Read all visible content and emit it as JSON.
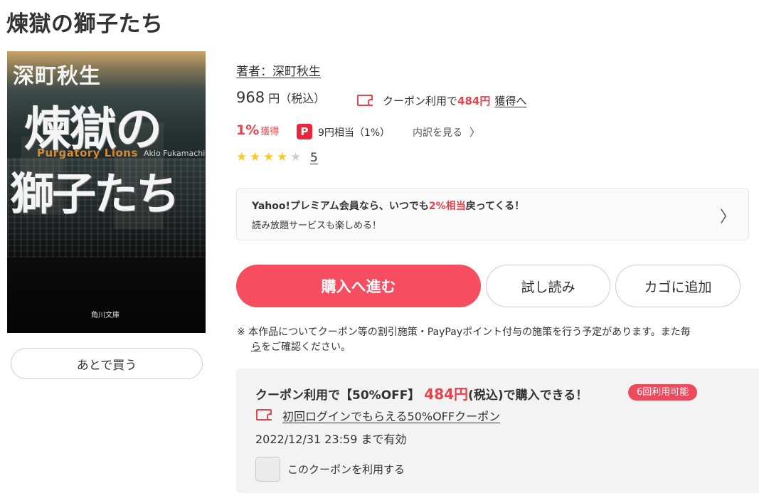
{
  "book": {
    "title": "煉獄の獅子たち",
    "cover": {
      "author": "深町秋生",
      "title_line_1": "煉獄の",
      "title_line_2": "獅子たち",
      "english_title": "Purgatory Lions",
      "english_author": "Akio Fukamachi",
      "publisher": "角川文庫"
    }
  },
  "actions": {
    "later_label": "あとで買う",
    "buy_label": "購入へ進む",
    "sample_label": "試し読み",
    "cart_label": "カゴに追加"
  },
  "info": {
    "author_link": "著者：深町秋生",
    "price_value": "968",
    "price_unit": "円（税込）",
    "coupon_prefix": "クーポン利用で",
    "coupon_price": "484円",
    "coupon_link": "獲得へ",
    "earn_percent": "1%",
    "earn_label": "獲得",
    "paypay_icon_glyph": "P",
    "paypay_amount": "9円相当（1%）",
    "breakdown_label": "内訳を見る",
    "rating_stars": 4,
    "rating_max": 5,
    "review_count": "5"
  },
  "premium": {
    "title_before": "Yahoo!プレミアム会員なら、いつでも",
    "title_highlight": "2%相当",
    "title_after": "戻ってくる！",
    "subtitle": "読み放題サービスも楽しめる！"
  },
  "notice": {
    "line1": "※ 本作品についてクーポン等の割引施策・PayPayポイント付与の施策を行う予定があります。また毎",
    "line2_link": "ら",
    "line2_rest": "をご確認ください。"
  },
  "coupon_panel": {
    "title_prefix": "クーポン利用で【50%OFF】",
    "title_price": "484円",
    "title_suffix": "(税込)で購入できる！",
    "badge": "6回利用可能",
    "coupon_name": "初回ログインでもらえる50%OFFクーポン",
    "valid_until": "2022/12/31 23:59 まで有効",
    "checkbox_label": "このクーポンを利用する",
    "checkbox_checked": false
  },
  "colors": {
    "accent_red": "#e5434e",
    "buy_button": "#f64d61",
    "star_on": "#f8c82d",
    "star_off": "#cfcfcf"
  },
  "icons": {
    "coupon": "coupon-ticket-icon",
    "paypay": "paypay-icon",
    "chevron": "chevron-right-icon",
    "star": "star-icon"
  }
}
